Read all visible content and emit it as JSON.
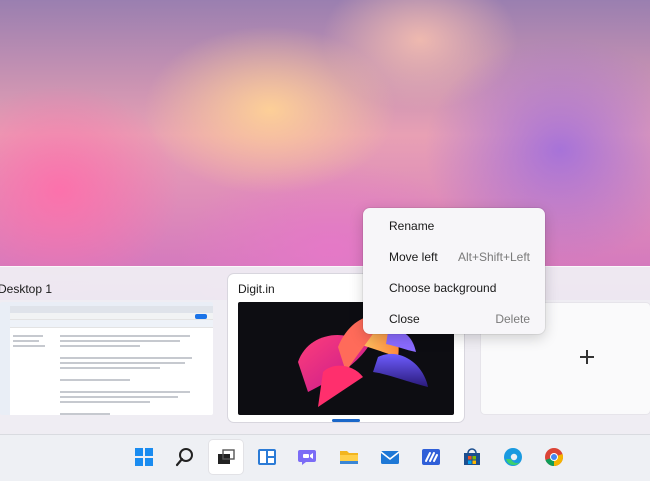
{
  "desktops": [
    {
      "label": "Desktop 1"
    },
    {
      "label": "Digit.in"
    }
  ],
  "context_menu": {
    "items": [
      {
        "label": "Rename",
        "shortcut": ""
      },
      {
        "label": "Move left",
        "shortcut": "Alt+Shift+Left"
      },
      {
        "label": "Choose background",
        "shortcut": ""
      },
      {
        "label": "Close",
        "shortcut": "Delete"
      }
    ]
  },
  "new_desktop": {
    "icon": "plus-icon"
  },
  "taskbar": {
    "icons": [
      "windows-start-icon",
      "search-icon",
      "task-view-icon",
      "widgets-icon",
      "teams-chat-icon",
      "file-explorer-icon",
      "mail-icon",
      "visual-studio-icon",
      "microsoft-store-icon",
      "edge-browser-icon",
      "chrome-browser-icon"
    ],
    "accent": "#1a67c9"
  }
}
